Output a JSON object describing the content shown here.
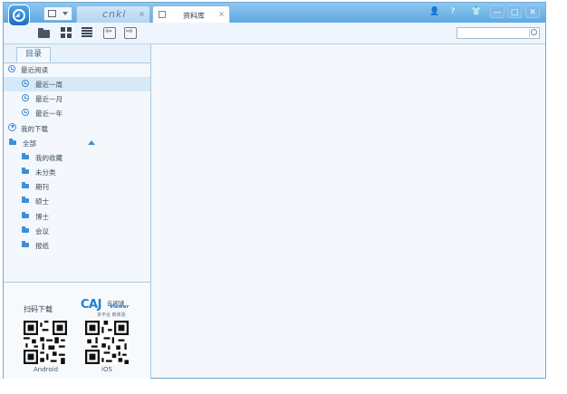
{
  "window": {
    "tabs": [
      {
        "id": "cnki",
        "logo_text": "cnki",
        "close": "×"
      },
      {
        "id": "library",
        "label": "资料库",
        "close": "×"
      }
    ],
    "system_buttons": [
      "👤",
      "?",
      "👕",
      "—",
      "□",
      "✕"
    ]
  },
  "toolbar": {
    "search_placeholder": ""
  },
  "sidebar": {
    "tab_label": "目录",
    "items": [
      {
        "label": "最近阅读",
        "icon": "clock-icon",
        "level": 0
      },
      {
        "label": "最近一周",
        "icon": "clock-icon",
        "level": 1,
        "selected": true
      },
      {
        "label": "最近一月",
        "icon": "clock-icon",
        "level": 1
      },
      {
        "label": "最近一年",
        "icon": "clock-icon",
        "level": 1
      },
      {
        "label": "我的下载",
        "icon": "download-icon",
        "level": 0
      },
      {
        "label": "全部",
        "icon": "folder-icon",
        "level": 0
      },
      {
        "label": "我的收藏",
        "icon": "folder-icon",
        "level": 1
      },
      {
        "label": "未分类",
        "icon": "folder-icon",
        "level": 1
      },
      {
        "label": "期刊",
        "icon": "folder-icon",
        "level": 1
      },
      {
        "label": "硕士",
        "icon": "folder-icon",
        "level": 1
      },
      {
        "label": "博士",
        "icon": "folder-icon",
        "level": 1
      },
      {
        "label": "会议",
        "icon": "folder-icon",
        "level": 1
      },
      {
        "label": "报纸",
        "icon": "folder-icon",
        "level": 1
      }
    ]
  },
  "promo": {
    "scan_text": "扫码下载",
    "caj_logo": "CAJ",
    "caj_name": "云阅读",
    "caj_viewer": "Viewer",
    "caj_slogan": "多平台 新体验",
    "android_label": "Android",
    "ios_label": "iOS"
  },
  "colors": {
    "accent": "#3e8dd6",
    "titlebar": "#5ea9e2",
    "selected_row": "#d6e9f8"
  }
}
